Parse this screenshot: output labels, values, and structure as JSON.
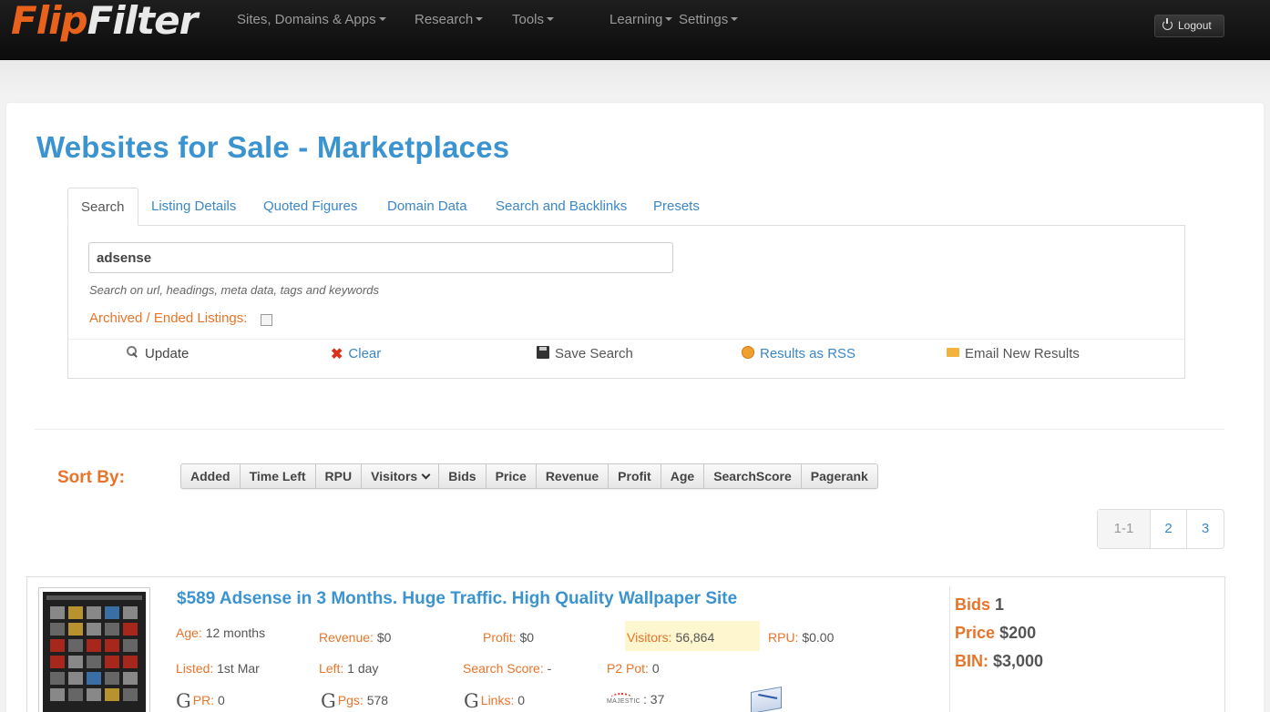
{
  "brand": {
    "part1": "Flip",
    "part2": "Filter"
  },
  "nav": {
    "items": [
      "Sites, Domains & Apps",
      "Research",
      "Tools",
      "Learning",
      "Settings"
    ],
    "logout": "Logout"
  },
  "page": {
    "title": "Websites for Sale - Marketplaces"
  },
  "tabs": [
    "Search",
    "Listing Details",
    "Quoted Figures",
    "Domain Data",
    "Search and Backlinks",
    "Presets"
  ],
  "search": {
    "value": "adsense",
    "help": "Search on url, headings, meta data, tags and keywords",
    "archived_label": "Archived / Ended Listings:"
  },
  "actions": {
    "update": "Update",
    "clear": "Clear",
    "save": "Save Search",
    "rss": "Results as RSS",
    "email": "Email New Results"
  },
  "sort": {
    "label": "Sort By:",
    "options": [
      "Added",
      "Time Left",
      "RPU",
      "Visitors",
      "Bids",
      "Price",
      "Revenue",
      "Profit",
      "Age",
      "SearchScore",
      "Pagerank"
    ]
  },
  "pagination": {
    "current": "1-1",
    "pages": [
      "2",
      "3"
    ]
  },
  "listing": {
    "title": "$589 Adsense in 3 Months. Huge Traffic. High Quality Wallpaper Site",
    "age_label": "Age:",
    "age": "12 months",
    "revenue_label": "Revenue:",
    "revenue": "$0",
    "profit_label": "Profit:",
    "profit": "$0",
    "visitors_label": "Visitors:",
    "visitors": "56,864",
    "rpu_label": "RPU:",
    "rpu": "$0.00",
    "listed_label": "Listed:",
    "listed": "1st Mar",
    "left_label": "Left:",
    "left": "1 day",
    "score_label": "Search Score:",
    "score": "-",
    "p2pot_label": "P2 Pot:",
    "p2pot": "0",
    "pr_label": "PR:",
    "pr": "0",
    "pgs_label": "Pgs:",
    "pgs": "578",
    "links_label": "Links:",
    "links": "0",
    "majestic_text": "MAJESTIC",
    "majestic": ": 37",
    "bids_label": "Bids",
    "bids": "1",
    "price_label": "Price",
    "price": "$200",
    "bin_label": "BIN:",
    "bin": "$3,000"
  },
  "colors": {
    "accent_blue": "#3b94cf",
    "accent_orange": "#e87429",
    "brand_orange": "#e8621c"
  }
}
